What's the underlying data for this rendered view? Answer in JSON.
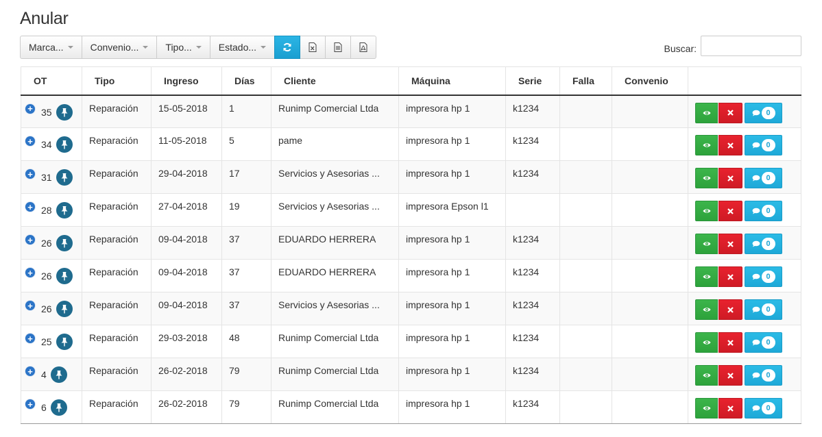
{
  "page": {
    "title": "Anular"
  },
  "toolbar": {
    "filters": [
      {
        "label": "Marca..."
      },
      {
        "label": "Convenio..."
      },
      {
        "label": "Tipo..."
      },
      {
        "label": "Estado..."
      }
    ],
    "refresh_icon": "refresh-icon",
    "export_icons": [
      "excel-icon",
      "csv-icon",
      "pdf-icon"
    ]
  },
  "search": {
    "label": "Buscar:",
    "value": "",
    "placeholder": ""
  },
  "table": {
    "headers": [
      "OT",
      "Tipo",
      "Ingreso",
      "Días",
      "Cliente",
      "Máquina",
      "Serie",
      "Falla",
      "Convenio",
      ""
    ],
    "rows": [
      {
        "ot": "35",
        "tipo": "Reparación",
        "ingreso": "15-05-2018",
        "dias": "1",
        "cliente": "Runimp Comercial Ltda",
        "maquina": "impresora hp 1",
        "serie": "k1234",
        "falla": "",
        "convenio": "",
        "comments": "0"
      },
      {
        "ot": "34",
        "tipo": "Reparación",
        "ingreso": "11-05-2018",
        "dias": "5",
        "cliente": "pame",
        "maquina": "impresora hp 1",
        "serie": "k1234",
        "falla": "",
        "convenio": "",
        "comments": "0"
      },
      {
        "ot": "31",
        "tipo": "Reparación",
        "ingreso": "29-04-2018",
        "dias": "17",
        "cliente": "Servicios y Asesorias ...",
        "maquina": "impresora hp 1",
        "serie": "k1234",
        "falla": "",
        "convenio": "",
        "comments": "0"
      },
      {
        "ot": "28",
        "tipo": "Reparación",
        "ingreso": "27-04-2018",
        "dias": "19",
        "cliente": "Servicios y Asesorias ...",
        "maquina": "impresora Epson l1",
        "serie": "",
        "falla": "",
        "convenio": "",
        "comments": "0"
      },
      {
        "ot": "26",
        "tipo": "Reparación",
        "ingreso": "09-04-2018",
        "dias": "37",
        "cliente": "EDUARDO HERRERA",
        "maquina": "impresora hp 1",
        "serie": "k1234",
        "falla": "",
        "convenio": "",
        "comments": "0"
      },
      {
        "ot": "26",
        "tipo": "Reparación",
        "ingreso": "09-04-2018",
        "dias": "37",
        "cliente": "EDUARDO HERRERA",
        "maquina": "impresora hp 1",
        "serie": "k1234",
        "falla": "",
        "convenio": "",
        "comments": "0"
      },
      {
        "ot": "26",
        "tipo": "Reparación",
        "ingreso": "09-04-2018",
        "dias": "37",
        "cliente": "Servicios y Asesorias ...",
        "maquina": "impresora hp 1",
        "serie": "k1234",
        "falla": "",
        "convenio": "",
        "comments": "0"
      },
      {
        "ot": "25",
        "tipo": "Reparación",
        "ingreso": "29-03-2018",
        "dias": "48",
        "cliente": "Runimp Comercial Ltda",
        "maquina": "impresora hp 1",
        "serie": "k1234",
        "falla": "",
        "convenio": "",
        "comments": "0"
      },
      {
        "ot": "4",
        "tipo": "Reparación",
        "ingreso": "26-02-2018",
        "dias": "79",
        "cliente": "Runimp Comercial Ltda",
        "maquina": "impresora hp 1",
        "serie": "k1234",
        "falla": "",
        "convenio": "",
        "comments": "0"
      },
      {
        "ot": "6",
        "tipo": "Reparación",
        "ingreso": "26-02-2018",
        "dias": "79",
        "cliente": "Runimp Comercial Ltda",
        "maquina": "impresora hp 1",
        "serie": "k1234",
        "falla": "",
        "convenio": "",
        "comments": "0"
      }
    ]
  },
  "colors": {
    "view": "#2da23b",
    "cancel": "#cf1b25",
    "comment": "#1ea9d8",
    "pin": "#1f6b8e",
    "refresh": "#1a9fd1"
  }
}
